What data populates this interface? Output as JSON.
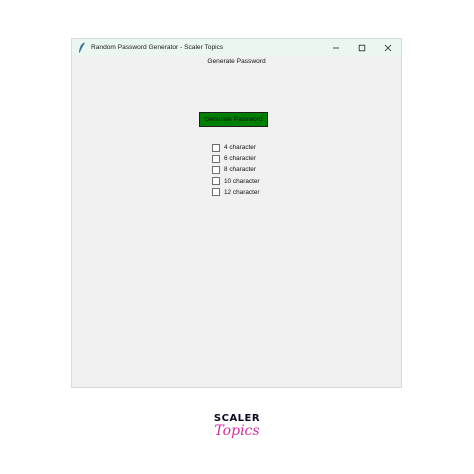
{
  "window": {
    "title": "Random Password Generator - Scaler Topics",
    "heading": "Generate Password",
    "controls": [
      "minimize-icon",
      "maximize-icon",
      "close-icon"
    ]
  },
  "generate_button": {
    "label": "Generate Password",
    "color": "#008000"
  },
  "options": [
    {
      "label": "4 character",
      "checked": false
    },
    {
      "label": "6 character",
      "checked": false
    },
    {
      "label": "8 character",
      "checked": false
    },
    {
      "label": "10 character",
      "checked": false
    },
    {
      "label": "12 character",
      "checked": false
    }
  ],
  "brand": {
    "line1": "SCALER",
    "line2": "Topics",
    "accent": "#d62ba3"
  }
}
